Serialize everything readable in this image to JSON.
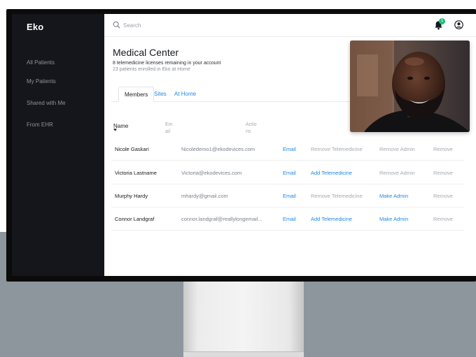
{
  "app": {
    "brand": "Eko"
  },
  "sidebar": {
    "items": [
      {
        "label": "All Patients"
      },
      {
        "label": "My Patients"
      },
      {
        "label": "Shared with Me"
      },
      {
        "label": "From EHR"
      }
    ]
  },
  "topbar": {
    "search_placeholder": "Search",
    "notification_count": "1",
    "icons": [
      "search-icon",
      "bell-icon",
      "user-account-icon"
    ]
  },
  "header": {
    "title": "Medical Center",
    "licenses_text": "8 telemedicine licenses remaining in your account",
    "enrolled_text": "23 patients enrolled in Eko at Home"
  },
  "tabs": [
    {
      "label": "Members",
      "active": true
    },
    {
      "label": "Sites",
      "active": false
    },
    {
      "label": "At Home",
      "active": false
    }
  ],
  "table": {
    "headers": {
      "name": "Name",
      "email_a": "Em",
      "email_b": "ail",
      "actions_a": "Actio",
      "actions_b": "ns"
    },
    "rows": [
      {
        "name": "Nicole Gaskari",
        "email": "Nicoledemo1@ekodevices.com",
        "email_link": "Email",
        "telemedicine": "Remove Telemedicine",
        "admin": "Remove Admin",
        "remove": "Remove"
      },
      {
        "name": "Victoria Lastname",
        "email": "Victoria@ekodevices.com",
        "email_link": "Email",
        "telemedicine": "Add Telemedicine",
        "admin": "Remove Admin",
        "remove": "Remove"
      },
      {
        "name": "Murphy Hardy",
        "email": "mhardy@gmail.com",
        "email_link": "Email",
        "telemedicine": "Remove Telemedicine",
        "admin": "Make Admin",
        "remove": "Remove"
      },
      {
        "name": "Connor Landgraf",
        "email": "connor.landgraf@reallylongemail...",
        "email_link": "Email",
        "telemedicine": "Add Telemedicine",
        "admin": "Make Admin",
        "remove": "Remove"
      }
    ]
  },
  "colors": {
    "sidebar_bg": "#14161b",
    "link_blue": "#1e88e5",
    "badge_green": "#1fbf7a",
    "muted_text": "#a4a9b0"
  }
}
